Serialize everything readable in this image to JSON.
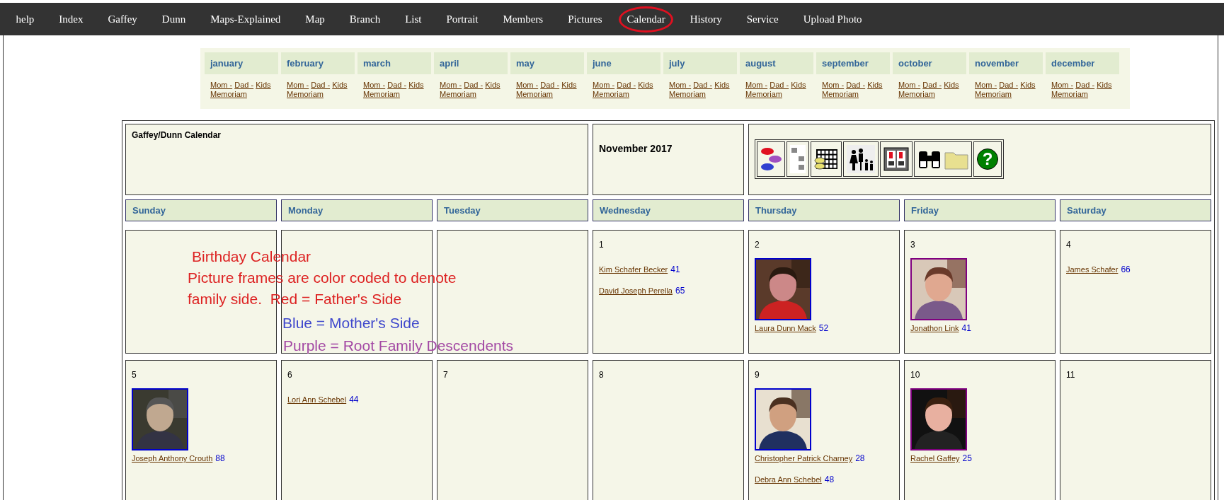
{
  "nav": [
    {
      "label": "help",
      "circled": false
    },
    {
      "label": "Index",
      "circled": false
    },
    {
      "label": "Gaffey",
      "circled": false
    },
    {
      "label": "Dunn",
      "circled": false
    },
    {
      "label": "Maps-Explained",
      "circled": false
    },
    {
      "label": "Map",
      "circled": false
    },
    {
      "label": "Branch",
      "circled": false
    },
    {
      "label": "List",
      "circled": false
    },
    {
      "label": "Portrait",
      "circled": false
    },
    {
      "label": "Members",
      "circled": false
    },
    {
      "label": "Pictures",
      "circled": false
    },
    {
      "label": "Calendar",
      "circled": true
    },
    {
      "label": "History",
      "circled": false
    },
    {
      "label": "Service",
      "circled": false
    },
    {
      "label": "Upload Photo",
      "circled": false
    }
  ],
  "months": [
    {
      "name": "january",
      "links": [
        "Mom -",
        "Dad -",
        "Kids",
        "Memoriam"
      ]
    },
    {
      "name": "february",
      "links": [
        "Mom -",
        "Dad -",
        "Kids",
        "Memoriam"
      ]
    },
    {
      "name": "march",
      "links": [
        "Mom -",
        "Dad -",
        "Kids",
        "Memoriam"
      ]
    },
    {
      "name": "april",
      "links": [
        "Mom -",
        "Dad -",
        "Kids",
        "Memoriam"
      ]
    },
    {
      "name": "may",
      "links": [
        "Mom -",
        "Dad -",
        "Kids",
        "Memoriam"
      ]
    },
    {
      "name": "june",
      "links": [
        "Mom -",
        "Dad -",
        "Kids",
        "Memoriam"
      ]
    },
    {
      "name": "july",
      "links": [
        "Mom -",
        "Dad -",
        "Kids",
        "Memoriam"
      ]
    },
    {
      "name": "august",
      "links": [
        "Mom -",
        "Dad -",
        "Kids",
        "Memoriam"
      ]
    },
    {
      "name": "september",
      "links": [
        "Mom -",
        "Dad -",
        "Kids",
        "Memoriam"
      ]
    },
    {
      "name": "october",
      "links": [
        "Mom -",
        "Dad -",
        "Kids",
        "Memoriam"
      ]
    },
    {
      "name": "november",
      "links": [
        "Mom -",
        "Dad -",
        "Kids",
        "Memoriam"
      ]
    },
    {
      "name": "december",
      "links": [
        "Mom -",
        "Dad -",
        "Kids",
        "Memoriam"
      ]
    }
  ],
  "calendar": {
    "title": "Gaffey/Dunn Calendar",
    "month": "November 2017",
    "toolbar": {
      "help_text": "?"
    },
    "weekdays": [
      "Sunday",
      "Monday",
      "Tuesday",
      "Wednesday",
      "Thursday",
      "Friday",
      "Saturday"
    ],
    "weeks": [
      [
        {
          "kind": "blank"
        },
        {
          "kind": "blank"
        },
        {
          "kind": "blank"
        },
        {
          "date": "1",
          "people": [
            {
              "name": "Kim Schafer Becker",
              "age": "41"
            },
            {
              "name": "David Joseph Perella",
              "age": "65"
            }
          ]
        },
        {
          "date": "2",
          "people": [
            {
              "name": "Laura Dunn Mack",
              "age": "52"
            }
          ]
        },
        {
          "date": "3",
          "people": [
            {
              "name": "Jonathon Link",
              "age": "41"
            }
          ]
        },
        {
          "date": "4",
          "people": [
            {
              "name": "James Schafer",
              "age": "66"
            }
          ]
        }
      ],
      [
        {
          "date": "5",
          "people": [
            {
              "name": "Joseph Anthony Crouth",
              "age": "88"
            }
          ]
        },
        {
          "date": "6",
          "people": [
            {
              "name": "Lori Ann Schebel",
              "age": "44"
            }
          ]
        },
        {
          "date": "7"
        },
        {
          "date": "8"
        },
        {
          "date": "9",
          "people": [
            {
              "name": "Christopher Patrick Charney",
              "age": "28"
            },
            {
              "name": "Debra Ann Schebel",
              "age": "48"
            }
          ]
        },
        {
          "date": "10",
          "people": [
            {
              "name": "Rachel Gaffey",
              "age": "25"
            }
          ]
        },
        {
          "date": "11"
        }
      ]
    ]
  },
  "annotation": {
    "title": "Birthday Calendar",
    "lines": [
      "Picture frames are color coded to denote",
      "family side.  Red = Father's Side"
    ],
    "legend": [
      {
        "text": "Blue = Mother's Side",
        "color": "#3f48cc"
      },
      {
        "text": "Purple = Root Family Descendents",
        "color": "#a349a4"
      }
    ]
  }
}
